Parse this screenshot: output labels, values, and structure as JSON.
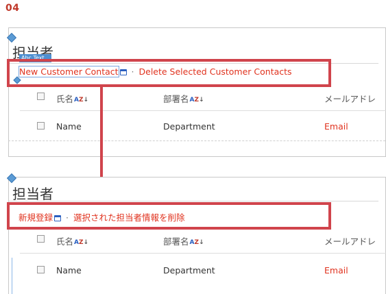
{
  "step": "04",
  "before": {
    "title": "担当者",
    "abc_tag": "Abc Text",
    "new_contact": "New Customer Contact",
    "separator": "·",
    "delete_contacts": "Delete Selected Customer Contacts",
    "columns": [
      "氏名",
      "部署名",
      "メールアドレ"
    ],
    "row": {
      "name": "Name",
      "department": "Department",
      "email": "Email"
    }
  },
  "after": {
    "title": "担当者",
    "new_contact": "新規登録",
    "separator": "·",
    "delete_contacts": "選択された担当者情報を削除",
    "columns": [
      "氏名",
      "部署名",
      "メールアドレ"
    ],
    "row": {
      "name": "Name",
      "department": "Department",
      "email": "Email"
    }
  },
  "colors": {
    "accent": "#e0321e",
    "highlight": "#d0444c",
    "icon_blue": "#2a5fc0"
  }
}
